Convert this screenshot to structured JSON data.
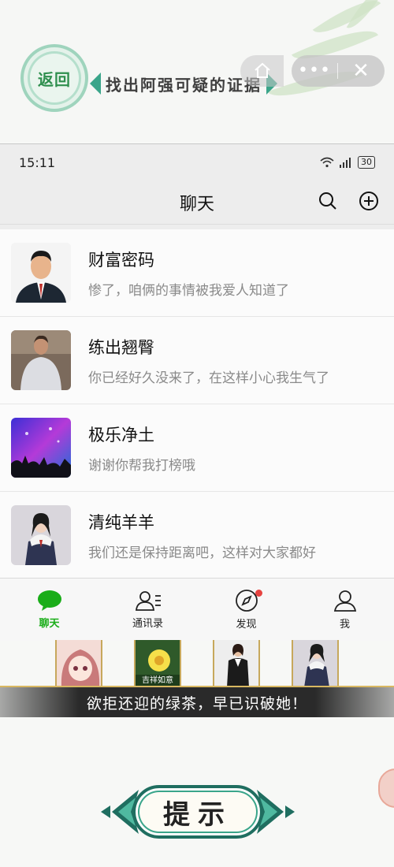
{
  "header": {
    "back_label": "返回",
    "title": "找出阿强可疑的证据",
    "home_icon": "home-icon",
    "more_icon": "more-icon",
    "close_icon": "close-icon"
  },
  "phone": {
    "status_time": "15:11",
    "battery": "30",
    "app_title": "聊天",
    "chats": [
      {
        "name": "财富密码",
        "message": "惨了，咱俩的事情被我爱人知道了",
        "avatar": "businessman-avatar"
      },
      {
        "name": "练出翘臀",
        "message": "你已经好久没来了，在这样小心我生气了",
        "avatar": "man-white-shirt-avatar"
      },
      {
        "name": "极乐净土",
        "message": "谢谢你帮我打榜哦",
        "avatar": "concert-avatar"
      },
      {
        "name": "清纯羊羊",
        "message": "我们还是保持距离吧，这样对大家都好",
        "avatar": "schoolgirl-avatar"
      }
    ],
    "tabs": [
      {
        "label": "聊天",
        "icon": "chat-bubble-icon",
        "active": true
      },
      {
        "label": "通讯录",
        "icon": "contacts-icon"
      },
      {
        "label": "发现",
        "icon": "compass-icon",
        "badge": true
      },
      {
        "label": "我",
        "icon": "person-icon"
      }
    ],
    "accent": "#1aad19"
  },
  "clues": {
    "cards": [
      {
        "icon": "anime-girl-portrait"
      },
      {
        "caption": "吉祥如意",
        "icon": "yellow-flower-card"
      },
      {
        "icon": "businesswoman-portrait"
      },
      {
        "icon": "schoolgirl-portrait"
      }
    ],
    "caption": "欲拒还迎的绿茶，早已识破她！"
  },
  "hint": {
    "label": "提示"
  }
}
